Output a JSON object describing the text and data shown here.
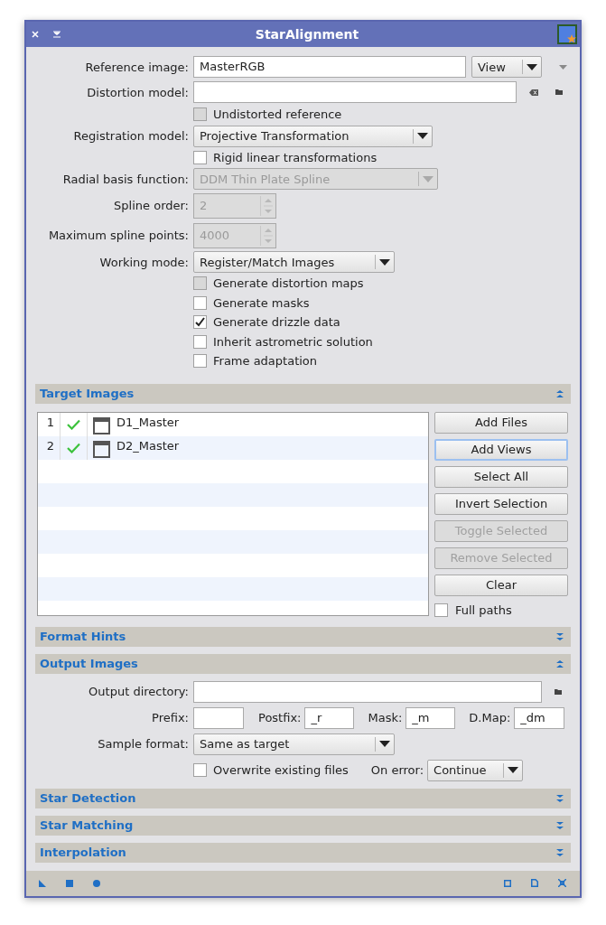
{
  "window": {
    "title": "StarAlignment"
  },
  "settings": [
    {
      "kind": "reference",
      "label": "Reference image:",
      "value": "MasterRGB",
      "combo": "View"
    },
    {
      "kind": "file",
      "label": "Distortion model:"
    },
    {
      "kind": "checkbox",
      "label": "Undistorted reference",
      "checked": false,
      "disabled": true
    },
    {
      "kind": "combo",
      "label": "Registration model:",
      "value": "Projective Transformation",
      "disabled": false
    },
    {
      "kind": "checkbox",
      "label": "Rigid linear transformations",
      "checked": false,
      "disabled": false
    },
    {
      "kind": "combo",
      "label": "Radial basis function:",
      "value": "DDM Thin Plate Spline",
      "disabled": true
    },
    {
      "kind": "spin",
      "label": "Spline order:",
      "value": "2",
      "disabled": true
    },
    {
      "kind": "spin",
      "label": "Maximum spline points:",
      "value": "4000",
      "disabled": true
    },
    {
      "kind": "combo",
      "label": "Working mode:",
      "value": "Register/Match Images",
      "disabled": false
    },
    {
      "kind": "checkbox",
      "label": "Generate distortion maps",
      "checked": false,
      "disabled": true
    },
    {
      "kind": "checkbox",
      "label": "Generate masks",
      "checked": false,
      "disabled": false
    },
    {
      "kind": "checkbox",
      "label": "Generate drizzle data",
      "checked": true,
      "disabled": false
    },
    {
      "kind": "checkbox",
      "label": "Inherit astrometric solution",
      "checked": false,
      "disabled": false
    },
    {
      "kind": "checkbox",
      "label": "Frame adaptation",
      "checked": false,
      "disabled": false
    }
  ],
  "sections": [
    {
      "kind": "targets",
      "title": "Target Images",
      "expanded": true,
      "rows": [
        {
          "index": "1",
          "enabled": true,
          "name": "D1_Master"
        },
        {
          "index": "2",
          "enabled": true,
          "name": "D2_Master"
        }
      ],
      "buttons": [
        {
          "label": "Add Files",
          "disabled": false,
          "focused": false
        },
        {
          "label": "Add Views",
          "disabled": false,
          "focused": true
        },
        {
          "label": "Select All",
          "disabled": false,
          "focused": false
        },
        {
          "label": "Invert Selection",
          "disabled": false,
          "focused": false
        },
        {
          "label": "Toggle Selected",
          "disabled": true,
          "focused": false
        },
        {
          "label": "Remove Selected",
          "disabled": true,
          "focused": false
        },
        {
          "label": "Clear",
          "disabled": false,
          "focused": false
        }
      ],
      "full_paths": {
        "label": "Full paths",
        "checked": false
      }
    },
    {
      "title": "Format Hints",
      "expanded": false
    },
    {
      "kind": "output",
      "title": "Output Images",
      "expanded": true,
      "output_directory": {
        "label": "Output directory:"
      },
      "affixes": [
        {
          "label": "Prefix:"
        },
        {
          "label": "Postfix:",
          "value": "_r"
        },
        {
          "label": "Mask:",
          "value": "_m"
        },
        {
          "label": "D.Map:",
          "value": "_dm"
        }
      ],
      "sample_format": {
        "label": "Sample format:",
        "value": "Same as target"
      },
      "overwrite": {
        "label": "Overwrite existing files",
        "checked": false
      },
      "on_error": {
        "label": "On error:",
        "value": "Continue"
      }
    },
    {
      "title": "Star Detection",
      "expanded": false
    },
    {
      "title": "Star Matching",
      "expanded": false
    },
    {
      "title": "Interpolation",
      "expanded": false
    }
  ]
}
